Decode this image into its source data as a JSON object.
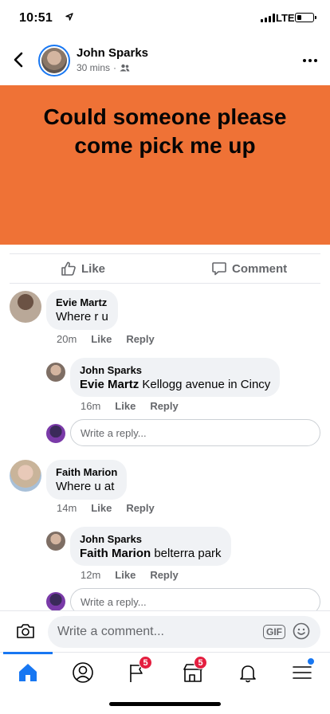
{
  "status": {
    "time": "10:51",
    "network": "LTE",
    "battery_level": 0.3
  },
  "header": {
    "name": "John Sparks",
    "time": "30 mins",
    "privacy_icon": "friends-icon"
  },
  "post": {
    "text_line1": "Could someone please",
    "text_line2": "come pick me up",
    "background": "#ef7236"
  },
  "actions": {
    "like": "Like",
    "comment": "Comment"
  },
  "comments": [
    {
      "name": "Evie Martz",
      "text": "Where r u",
      "time": "20m",
      "like": "Like",
      "reply": "Reply",
      "replies": [
        {
          "name": "John Sparks",
          "mention": "Evie Martz",
          "text": "Kellogg avenue in Cincy",
          "time": "16m",
          "like": "Like",
          "reply": "Reply"
        }
      ],
      "reply_placeholder": "Write a reply..."
    },
    {
      "name": "Faith Marion",
      "text": "Where u at",
      "time": "14m",
      "like": "Like",
      "reply": "Reply",
      "replies": [
        {
          "name": "John Sparks",
          "mention": "Faith Marion",
          "text": "belterra park",
          "time": "12m",
          "like": "Like",
          "reply": "Reply"
        }
      ],
      "reply_placeholder": "Write a reply..."
    }
  ],
  "composer": {
    "placeholder": "Write a comment...",
    "gif": "GIF"
  },
  "tabbar": {
    "items": [
      {
        "icon": "home-icon",
        "active": true
      },
      {
        "icon": "profile-icon"
      },
      {
        "icon": "flag-icon",
        "badge": "5"
      },
      {
        "icon": "marketplace-icon",
        "badge": "5"
      },
      {
        "icon": "bell-icon"
      },
      {
        "icon": "menu-icon",
        "dot": true
      }
    ]
  },
  "colors": {
    "accent": "#1877f2",
    "badge": "#e41e3f",
    "bubble": "#f0f2f5"
  }
}
